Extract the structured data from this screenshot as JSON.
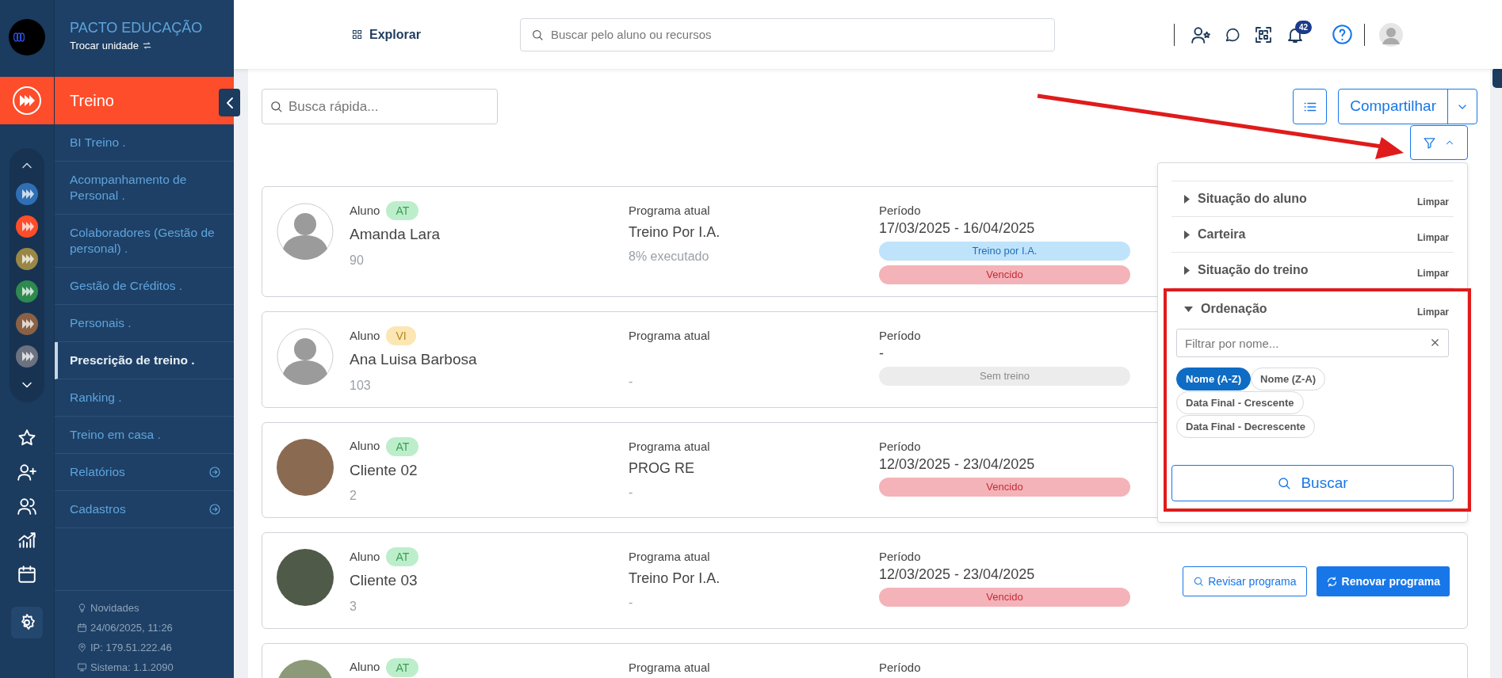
{
  "brand": {
    "title": "PACTO EDUCAÇÃO",
    "switch_unit": "Trocar unidade"
  },
  "rail": {
    "modules": [
      {
        "color": "#2f6fb5"
      },
      {
        "color": "#fe4d2a"
      },
      {
        "color": "#9a8745"
      },
      {
        "color": "#2e8a4f"
      },
      {
        "color": "#8a6146"
      },
      {
        "color": "#6b7280"
      }
    ]
  },
  "module": {
    "title": "Treino"
  },
  "sidebar": {
    "items": [
      {
        "label": "BI Treino .",
        "kind": "link",
        "selected": false
      },
      {
        "label": "Acompanhamento de Personal .",
        "kind": "link",
        "selected": false
      },
      {
        "label": "Colaboradores (Gestão de personal) .",
        "kind": "link",
        "selected": false
      },
      {
        "label": "Gestão de Créditos .",
        "kind": "link",
        "selected": false
      },
      {
        "label": "Personais .",
        "kind": "link",
        "selected": false
      },
      {
        "label": "Prescrição de treino .",
        "kind": "link",
        "selected": true
      },
      {
        "label": "Ranking .",
        "kind": "link",
        "selected": false
      },
      {
        "label": "Treino em casa .",
        "kind": "link",
        "selected": false
      },
      {
        "label": "Relatórios",
        "kind": "group",
        "selected": false
      },
      {
        "label": "Cadastros",
        "kind": "group",
        "selected": false
      }
    ]
  },
  "footer": [
    {
      "kind": "news",
      "text": "Novidades"
    },
    {
      "kind": "date",
      "text": "24/06/2025, 11:26"
    },
    {
      "kind": "ip",
      "text": "IP: 179.51.222.46"
    },
    {
      "kind": "system",
      "text": "Sistema: 1.1.2090"
    }
  ],
  "topbar": {
    "explore": "Explorar",
    "search_placeholder": "Buscar pelo aluno ou recursos",
    "notification_count": "42"
  },
  "toolbar": {
    "quick_search_placeholder": "Busca rápida...",
    "share": "Compartilhar"
  },
  "filter_panel": {
    "sections": [
      {
        "title": "Situação do aluno",
        "clear": "Limpar",
        "expanded": false
      },
      {
        "title": "Carteira",
        "clear": "Limpar",
        "expanded": false
      },
      {
        "title": "Situação do treino",
        "clear": "Limpar",
        "expanded": false
      },
      {
        "title": "Ordenação",
        "clear": "Limpar",
        "expanded": true
      }
    ],
    "name_filter_placeholder": "Filtrar por nome...",
    "options": [
      {
        "label": "Nome (A-Z)",
        "selected": true
      },
      {
        "label": "Nome (Z-A)",
        "selected": false
      },
      {
        "label": "Data Final - Crescente",
        "selected": false
      },
      {
        "label": "Data Final - Decrescente",
        "selected": false
      }
    ],
    "search_button": "Buscar"
  },
  "students": [
    {
      "avatar": {
        "kind": "default"
      },
      "student_label": "Aluno",
      "status": {
        "text": "AT",
        "kind": "at"
      },
      "name": "Amanda Lara",
      "id": "90",
      "program_label": "Programa atual",
      "program": "Treino Por I.A.",
      "program_sub": "8% executado",
      "period_label": "Período",
      "period": "17/03/2025 - 16/04/2025",
      "tags": [
        {
          "text": "Treino por I.A.",
          "kind": "ai"
        },
        {
          "text": "Vencido",
          "kind": "expired"
        }
      ]
    },
    {
      "avatar": {
        "kind": "default"
      },
      "student_label": "Aluno",
      "status": {
        "text": "VI",
        "kind": "vi"
      },
      "name": "Ana Luisa Barbosa",
      "id": "103",
      "program_label": "Programa atual",
      "program_sub": "-",
      "period_label": "Período",
      "period": "-",
      "tags": [
        {
          "text": "Sem treino",
          "kind": "none"
        }
      ]
    },
    {
      "avatar": {
        "kind": "photo"
      },
      "student_label": "Aluno",
      "status": {
        "text": "AT",
        "kind": "at"
      },
      "name": "Cliente 02",
      "id": "2",
      "program_label": "Programa atual",
      "program": "PROG RE",
      "program_sub": "-",
      "period_label": "Período",
      "period": "12/03/2025 - 23/04/2025",
      "tags": [
        {
          "text": "Vencido",
          "kind": "expired"
        }
      ]
    },
    {
      "avatar": {
        "kind": "photo"
      },
      "student_label": "Aluno",
      "status": {
        "text": "AT",
        "kind": "at"
      },
      "name": "Cliente 03",
      "id": "3",
      "program_label": "Programa atual",
      "program": "Treino Por I.A.",
      "program_sub": "-",
      "period_label": "Período",
      "period": "12/03/2025 - 23/04/2025",
      "tags": [
        {
          "text": "Vencido",
          "kind": "expired"
        }
      ],
      "actions": [
        {
          "label": "Revisar programa",
          "kind": "review"
        },
        {
          "label": "Renovar programa",
          "kind": "renew"
        }
      ]
    },
    {
      "avatar": {
        "kind": "photo"
      },
      "student_label": "Aluno",
      "status": {
        "text": "AT",
        "kind": "at"
      },
      "program_label": "Programa atual",
      "period_label": "Período"
    }
  ]
}
